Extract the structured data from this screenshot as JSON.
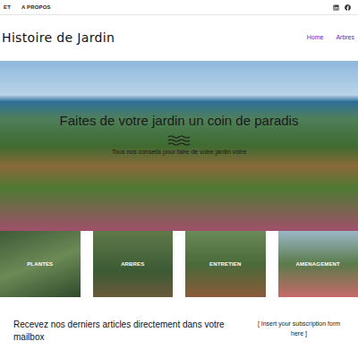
{
  "topbar": {
    "links": [
      "ET",
      "A PROPOS"
    ]
  },
  "logo": "Histoire de Jardin",
  "nav": [
    {
      "label": "Home",
      "selected": false
    },
    {
      "label": "Arbres",
      "selected": false
    }
  ],
  "hero": {
    "title": "Faites de votre jardin un coin de paradis",
    "subtitle": "Tous nos conseils pour faire de votre jardin votre"
  },
  "categories": [
    {
      "label": "PLANTES"
    },
    {
      "label": "ARBRES"
    },
    {
      "label": "ENTRETIEN"
    },
    {
      "label": "AMENAGEMENT"
    }
  ],
  "newsletter": {
    "title": "Recevez nos derniers articles directement dans votre mailbox",
    "form": "[ Insert your subscription form here ]"
  }
}
